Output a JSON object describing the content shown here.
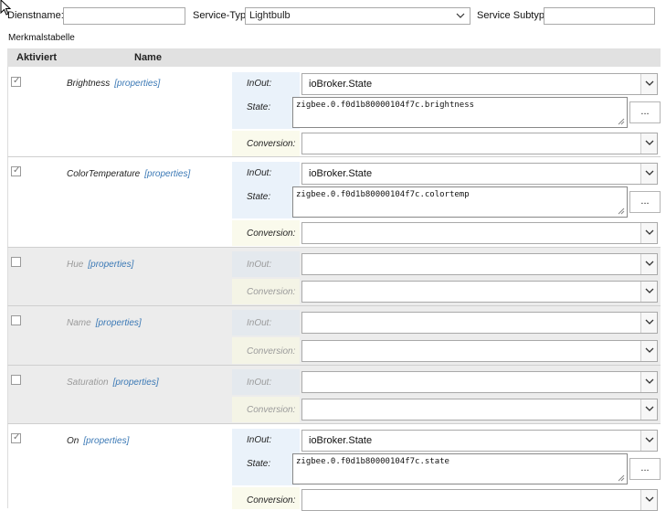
{
  "header": {
    "servicename_label": "Dienstname:",
    "servicename_value": "",
    "servicetype_label": "Service-Typ:",
    "servicetype_value": "Lightbulb",
    "subtype_label": "Service Subtyp:",
    "subtype_value": ""
  },
  "section_title": "Merkmalstabelle",
  "table": {
    "col_active": "Aktiviert",
    "col_name": "Name",
    "rows": [
      {
        "name": "Brightness",
        "props": "[properties]",
        "enabled": true,
        "inout_label": "InOut:",
        "inout_value": "ioBroker.State",
        "state_label": "State:",
        "state_value": "zigbee.0.f0d1b80000104f7c.brightness",
        "conv_label": "Conversion:",
        "conv_value": "",
        "dots": "..."
      },
      {
        "name": "ColorTemperature",
        "props": "[properties]",
        "enabled": true,
        "inout_label": "InOut:",
        "inout_value": "ioBroker.State",
        "state_label": "State:",
        "state_value": "zigbee.0.f0d1b80000104f7c.colortemp",
        "conv_label": "Conversion:",
        "conv_value": "",
        "dots": "..."
      },
      {
        "name": "Hue",
        "props": "[properties]",
        "enabled": false,
        "inout_label": "InOut:",
        "inout_value": "",
        "conv_label": "Conversion:",
        "conv_value": ""
      },
      {
        "name": "Name",
        "props": "[properties]",
        "enabled": false,
        "inout_label": "InOut:",
        "inout_value": "",
        "conv_label": "Conversion:",
        "conv_value": ""
      },
      {
        "name": "Saturation",
        "props": "[properties]",
        "enabled": false,
        "inout_label": "InOut:",
        "inout_value": "",
        "conv_label": "Conversion:",
        "conv_value": ""
      },
      {
        "name": "On",
        "props": "[properties]",
        "enabled": true,
        "inout_label": "InOut:",
        "inout_value": "ioBroker.State",
        "state_label": "State:",
        "state_value": "zigbee.0.f0d1b80000104f7c.state",
        "conv_label": "Conversion:",
        "conv_value": "",
        "dots": "..."
      }
    ]
  },
  "icons": {
    "dropdown": "chevron-down-icon",
    "checkbox": "checkmark-icon",
    "resize": "resize-grip-icon",
    "pointer": "mouse-pointer-icon"
  }
}
